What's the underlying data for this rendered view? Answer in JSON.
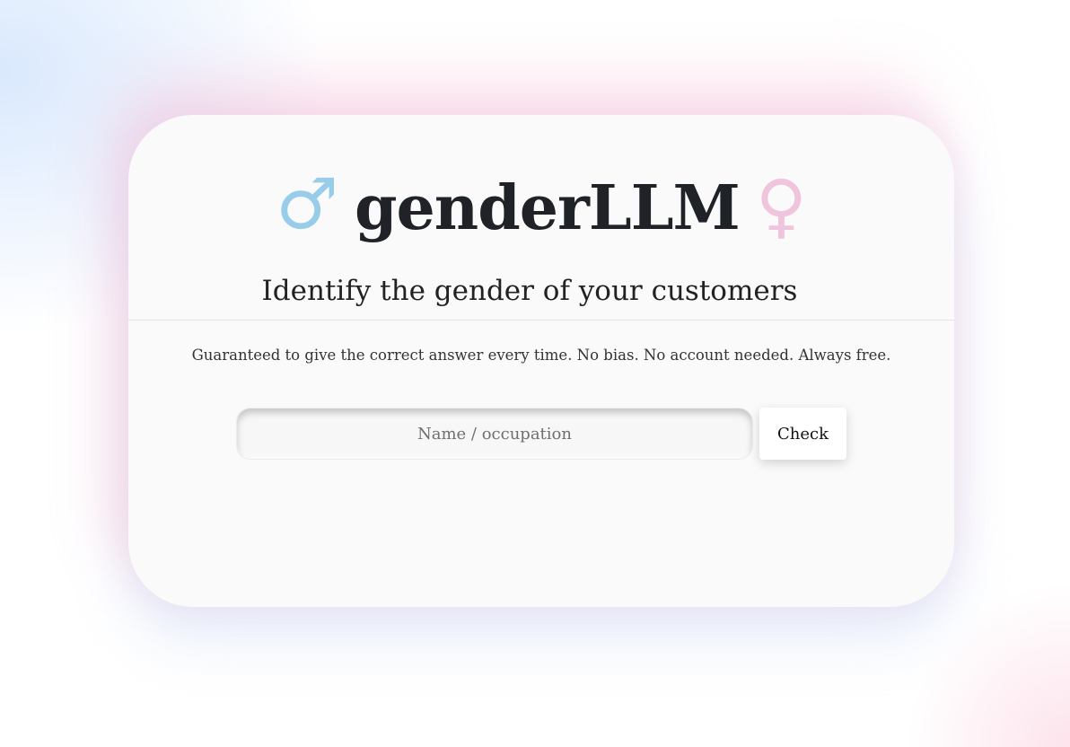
{
  "header": {
    "male_symbol": "♂",
    "title": "genderLLM",
    "female_symbol": "♀",
    "male_icon": "male-symbol-icon",
    "female_icon": "female-symbol-icon"
  },
  "main": {
    "subtitle": "Identify the gender of your customers",
    "tagline": "Guaranteed to give the correct answer every time. No bias. No account needed. Always free."
  },
  "form": {
    "input_placeholder": "Name / occupation",
    "input_value": "",
    "button_label": "Check"
  },
  "colors": {
    "male": "#98cdea",
    "female": "#f0c4dd",
    "title": "#1f2328",
    "card": "#fafafa"
  }
}
